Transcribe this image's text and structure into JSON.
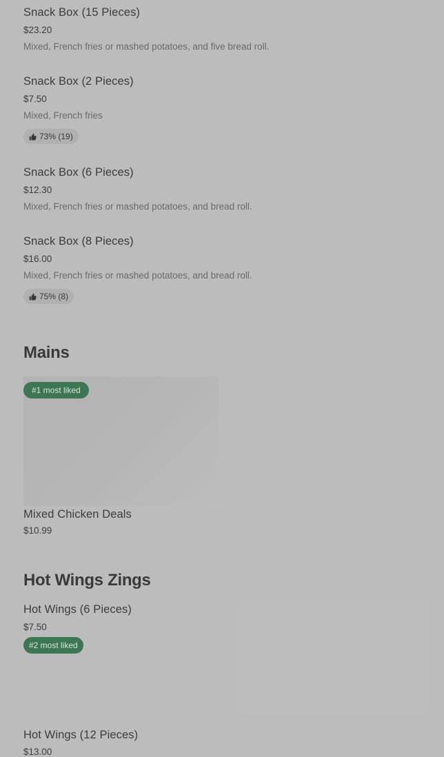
{
  "snack_items": [
    {
      "title": "Snack Box (15 Pieces)",
      "price": "$23.20",
      "description": "Mixed, French fries or mashed potatoes, and five bread roll.",
      "rating": ""
    },
    {
      "title": "Snack Box (2 Pieces)",
      "price": "$7.50",
      "description": "Mixed, French fries",
      "rating": "73% (19)"
    },
    {
      "title": "Snack Box (6 Pieces)",
      "price": "$12.30",
      "description": "Mixed, French fries or mashed potatoes, and bread roll.",
      "rating": ""
    },
    {
      "title": "Snack Box (8 Pieces)",
      "price": "$16.00",
      "description": "Mixed, French fries or mashed potatoes, and bread roll.",
      "rating": "75% (8)"
    }
  ],
  "mains": {
    "section_title": "Mains",
    "items": [
      {
        "badge": "#1 most liked",
        "title": "Mixed Chicken Deals",
        "price": "$10.99"
      }
    ]
  },
  "hot_wings": {
    "section_title": "Hot Wings Zings",
    "items": [
      {
        "title": "Hot Wings (6 Pieces)",
        "price": "$7.50",
        "badge": "#2 most liked"
      },
      {
        "title": "Hot Wings (12 Pieces)",
        "price": "$13.00"
      }
    ]
  },
  "icons": {
    "rating": "thumbs-up-icon"
  },
  "colors": {
    "background": "#bcbcbc",
    "badge_bg": "#3e7653",
    "badge_text": "#d4e5d8",
    "rating_pill_bg": "#b0b0b0"
  }
}
